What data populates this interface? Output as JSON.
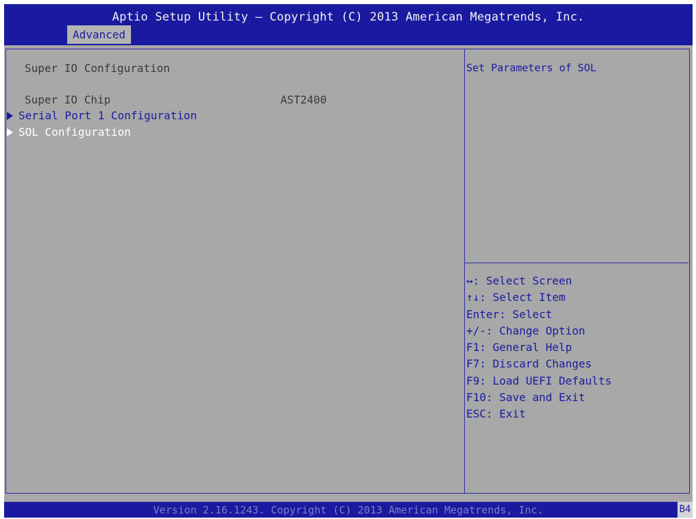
{
  "header": {
    "title": "Aptio Setup Utility – Copyright (C) 2013 American Megatrends, Inc.",
    "active_tab": "Advanced"
  },
  "main": {
    "section_title": "Super IO Configuration",
    "chip_label": "Super IO Chip",
    "chip_value": "AST2400",
    "menu_items": [
      {
        "label": "Serial Port 1 Configuration",
        "selected": false
      },
      {
        "label": "SOL Configuration",
        "selected": true
      }
    ]
  },
  "help": {
    "text": "Set Parameters of SOL"
  },
  "keys": [
    "↔: Select Screen",
    "↑↓: Select Item",
    "Enter: Select",
    "+/-: Change Option",
    "F1: General Help",
    "F7: Discard Changes",
    "F9: Load UEFI Defaults",
    "F10: Save and Exit",
    "ESC: Exit"
  ],
  "footer": {
    "text": "Version 2.16.1243. Copyright (C) 2013 American Megatrends, Inc.",
    "code": "B4"
  },
  "colors": {
    "header_blue": "#1a1aa0",
    "panel_gray": "#a8a8a8",
    "text_blue": "#1a1aa0",
    "selected_text": "#ffffff"
  }
}
